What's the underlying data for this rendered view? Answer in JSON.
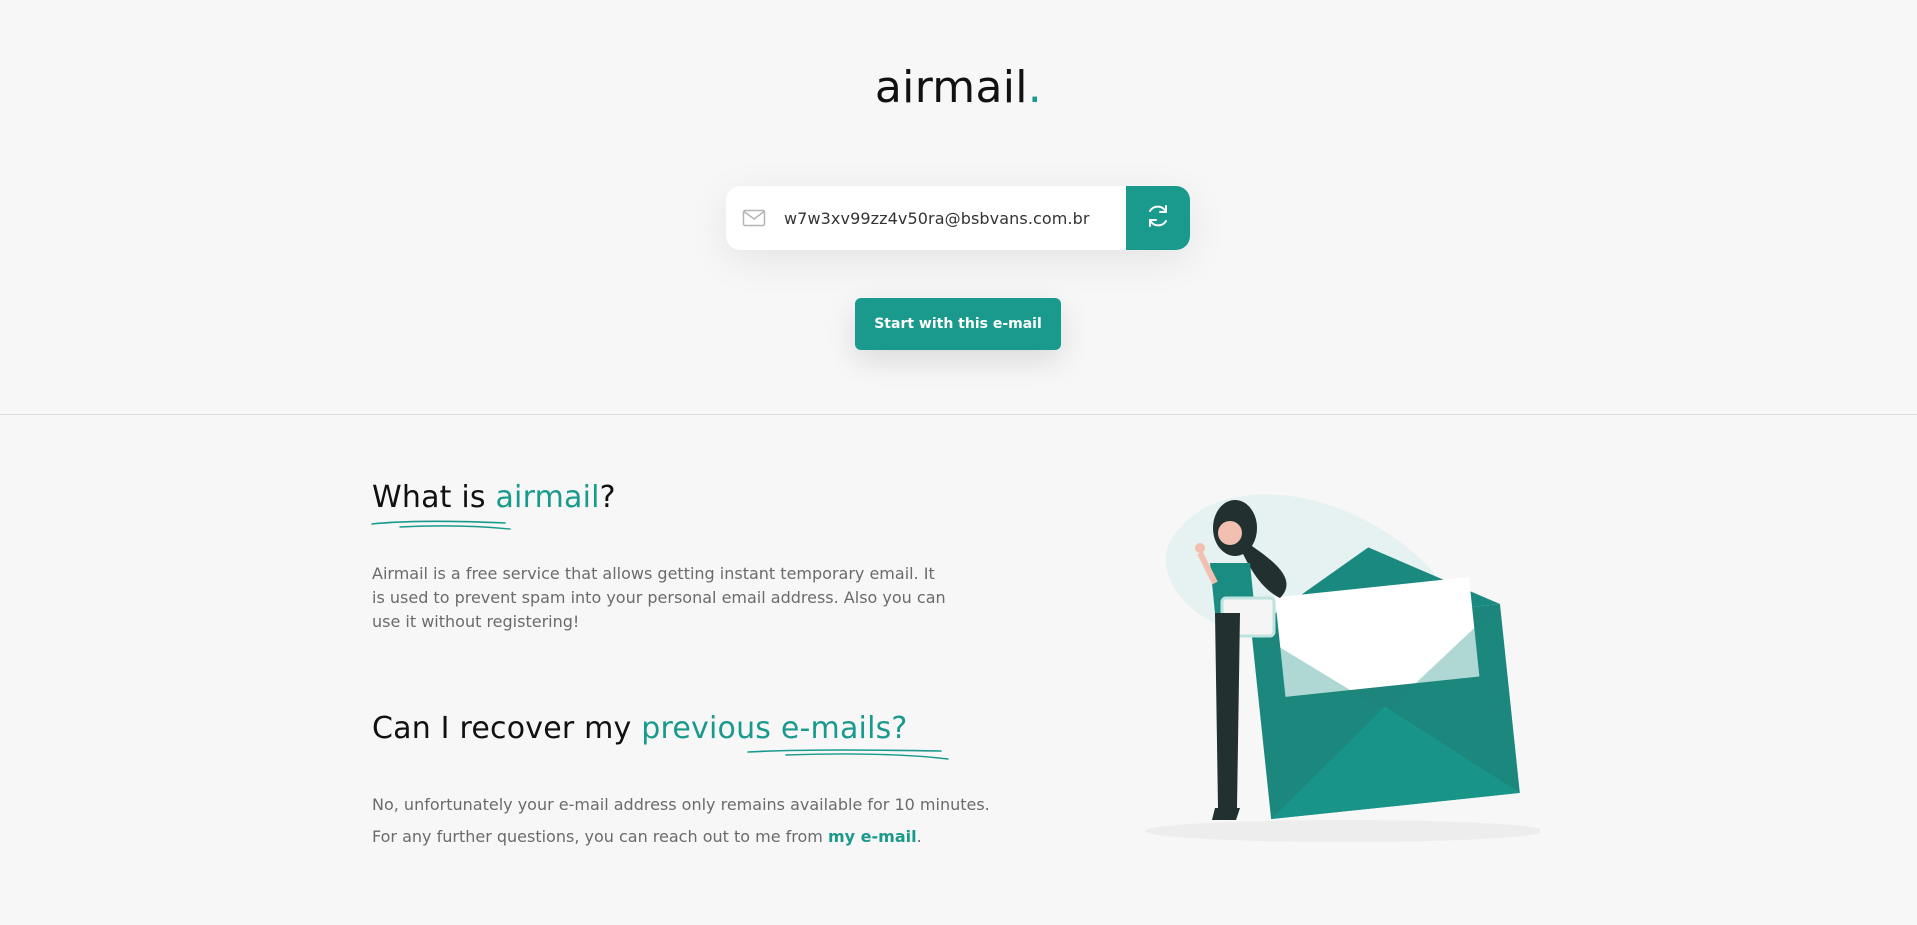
{
  "logo": {
    "text": "airmail",
    "dot": "."
  },
  "email": {
    "address": "w7w3xv99zz4v50ra@bsbvans.com.br"
  },
  "icons": {
    "mail": "mail-icon",
    "refresh": "refresh-icon"
  },
  "start_button": {
    "label": "Start with this e-mail"
  },
  "section1": {
    "title_prefix": "What is ",
    "title_accent": "airmail",
    "title_suffix": "?",
    "body": "Airmail is a free service that allows getting instant temporary email. It is used to prevent spam into your personal email address. Also you can use it without registering!"
  },
  "section2": {
    "title_prefix": "Can I recover my ",
    "title_accent": "previous e-mails?",
    "body1": "No, unfortunately your e-mail address only remains available for 10 minutes.",
    "body2_prefix": "For any further questions, you can reach out to me from ",
    "link": "my e-mail",
    "body2_suffix": "."
  },
  "colors": {
    "accent": "#1a9a8d",
    "background": "#f7f7f7",
    "text": "#111111",
    "muted": "#6b6b6b"
  }
}
